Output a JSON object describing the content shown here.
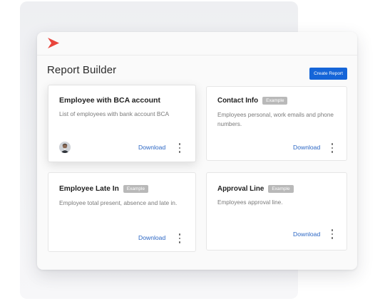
{
  "header": {
    "title": "Report Builder",
    "create_label": "Create Report"
  },
  "cards": [
    {
      "title": "Employee with BCA account",
      "badge": "",
      "description": "List of employees with bank account BCA",
      "download": "Download"
    },
    {
      "title": "Contact Info",
      "badge": "Example",
      "description": "Employees personal, work emails and phone numbers.",
      "download": "Download"
    },
    {
      "title": "Employee Late In",
      "badge": "Example",
      "description": "Employee total present, absence and late in.",
      "download": "Download"
    },
    {
      "title": "Approval Line",
      "badge": "Example",
      "description": "Employees approval line.",
      "download": "Download"
    }
  ],
  "colors": {
    "accent": "#1565d8",
    "logo": "#e8453c",
    "link": "#2b66c4",
    "badge": "#b9b9b9"
  }
}
